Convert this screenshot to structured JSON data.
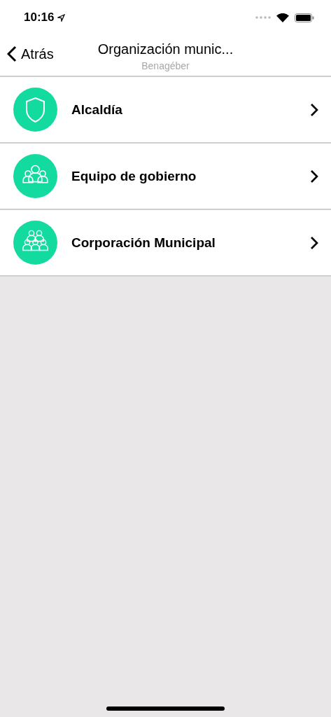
{
  "status_bar": {
    "time": "10:16"
  },
  "nav_bar": {
    "back": "Atrás",
    "title": "Organización munic...",
    "subtitle": "Benagéber"
  },
  "items": [
    {
      "label": "Alcaldía",
      "kind": "shield"
    },
    {
      "label": "Equipo de gobierno",
      "kind": "group"
    },
    {
      "label": "Corporación Municipal",
      "kind": "crowd"
    }
  ]
}
